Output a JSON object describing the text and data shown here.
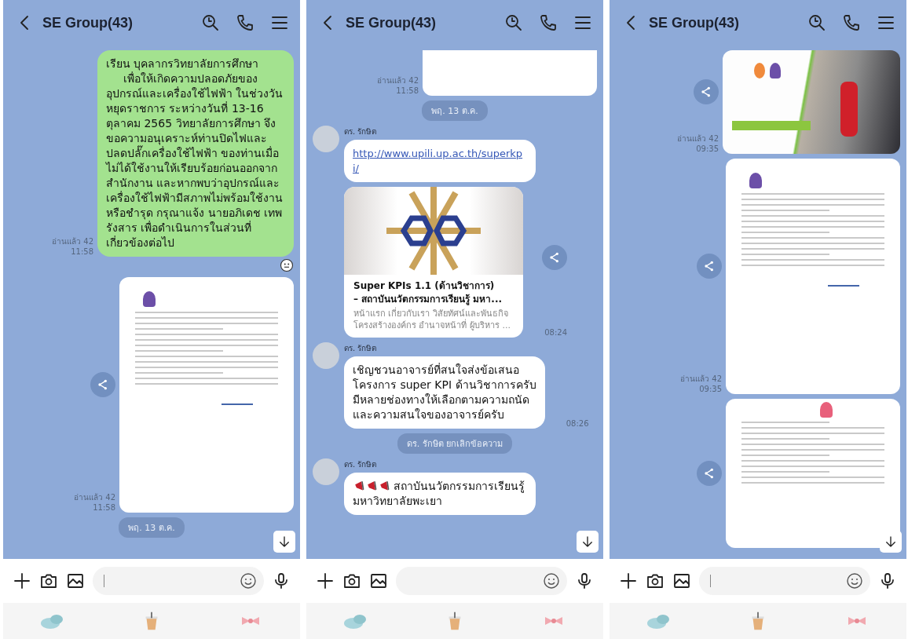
{
  "panels": [
    {
      "header": {
        "title": "SE Group(43)"
      },
      "messages": [
        {
          "kind": "out_text",
          "text": "เรียน บุคลากรวิทยาลัยการศึกษา\n     เพื่อให้เกิดความปลอดภัยของอุปกรณ์และเครื่องใช้ไฟฟ้า ในช่วงวันหยุดราชการ ระหว่างวันที่ 13-16 ตุลาคม 2565 วิทยาลัยการศึกษา จึงขอความอนุเคราะห์ท่านปิดไฟและปลดปลั๊กเครื่องใช้ไฟฟ้า ของท่านเมื่อไม่ได้ใช้งานให้เรียบร้อยก่อนออกจากสำนักงาน และหากพบว่าอุปกรณ์และเครื่องใช้ไฟฟ้ามีสภาพไม่พร้อมใช้งาน หรือชำรุด กรุณาแจ้ง นายอภิเดช เทพรังสาร เพื่อดำเนินการในส่วนที่เกี่ยวข้องต่อไป",
          "read": "อ่านแล้ว 42",
          "time": "11:58",
          "reaction": true
        },
        {
          "kind": "out_document",
          "read": "อ่านแล้ว 42",
          "time": "11:58",
          "share": true
        },
        {
          "kind": "date",
          "text": "พฤ. 13 ต.ค."
        }
      ],
      "composer": {
        "cursor": true
      }
    },
    {
      "header": {
        "title": "SE Group(43)"
      },
      "messages": [
        {
          "kind": "out_cutoff_image",
          "read": "อ่านแล้ว 42",
          "time": "11:58"
        },
        {
          "kind": "date",
          "text": "พฤ. 13 ต.ค."
        },
        {
          "kind": "in_link",
          "sender": "ดร. รักษิต",
          "url": "http://www.upili.up.ac.th/superkpi/"
        },
        {
          "kind": "link_card",
          "title": "Super KPIs 1.1 (ด้านวิชาการ)\n– สถาบันนวัตกรรมการเรียนรู้ มหา...",
          "description": "หน้าแรก เกี่ยวกับเรา วิสัยทัศน์และพันธกิจ โครงสร้างองค์กร อำนาจหน้าที่ ผู้บริหาร ...",
          "time": "08:24",
          "share": true
        },
        {
          "kind": "in_text",
          "sender": "ดร. รักษิต",
          "text": "เชิญชวนอาจารย์ที่สนใจส่งข้อเสนอ\nโครงการ super KPI ด้านวิชาการครับ\nมีหลายช่องทางให้เลือกตามความถนัด\nและความสนใจของอาจารย์ครับ",
          "time": "08:26"
        },
        {
          "kind": "system",
          "text": "ดร. รักษิต ยกเลิกข้อความ"
        },
        {
          "kind": "announcement",
          "sender": "ดร. รักษิต",
          "text": "สถาบันนวัตกรรมการเรียนรู้\nมหาวิทยาลัยพะเยา"
        }
      ],
      "composer": {
        "cursor": false
      }
    },
    {
      "header": {
        "title": "SE Group(43)"
      },
      "messages": [
        {
          "kind": "out_poster",
          "read": "อ่านแล้ว 42",
          "time": "09:35",
          "share": true
        },
        {
          "kind": "out_document",
          "read": "อ่านแล้ว 42",
          "time": "09:35",
          "share": true
        },
        {
          "kind": "out_agenda",
          "share": true
        }
      ],
      "composer": {
        "cursor": true
      }
    }
  ]
}
